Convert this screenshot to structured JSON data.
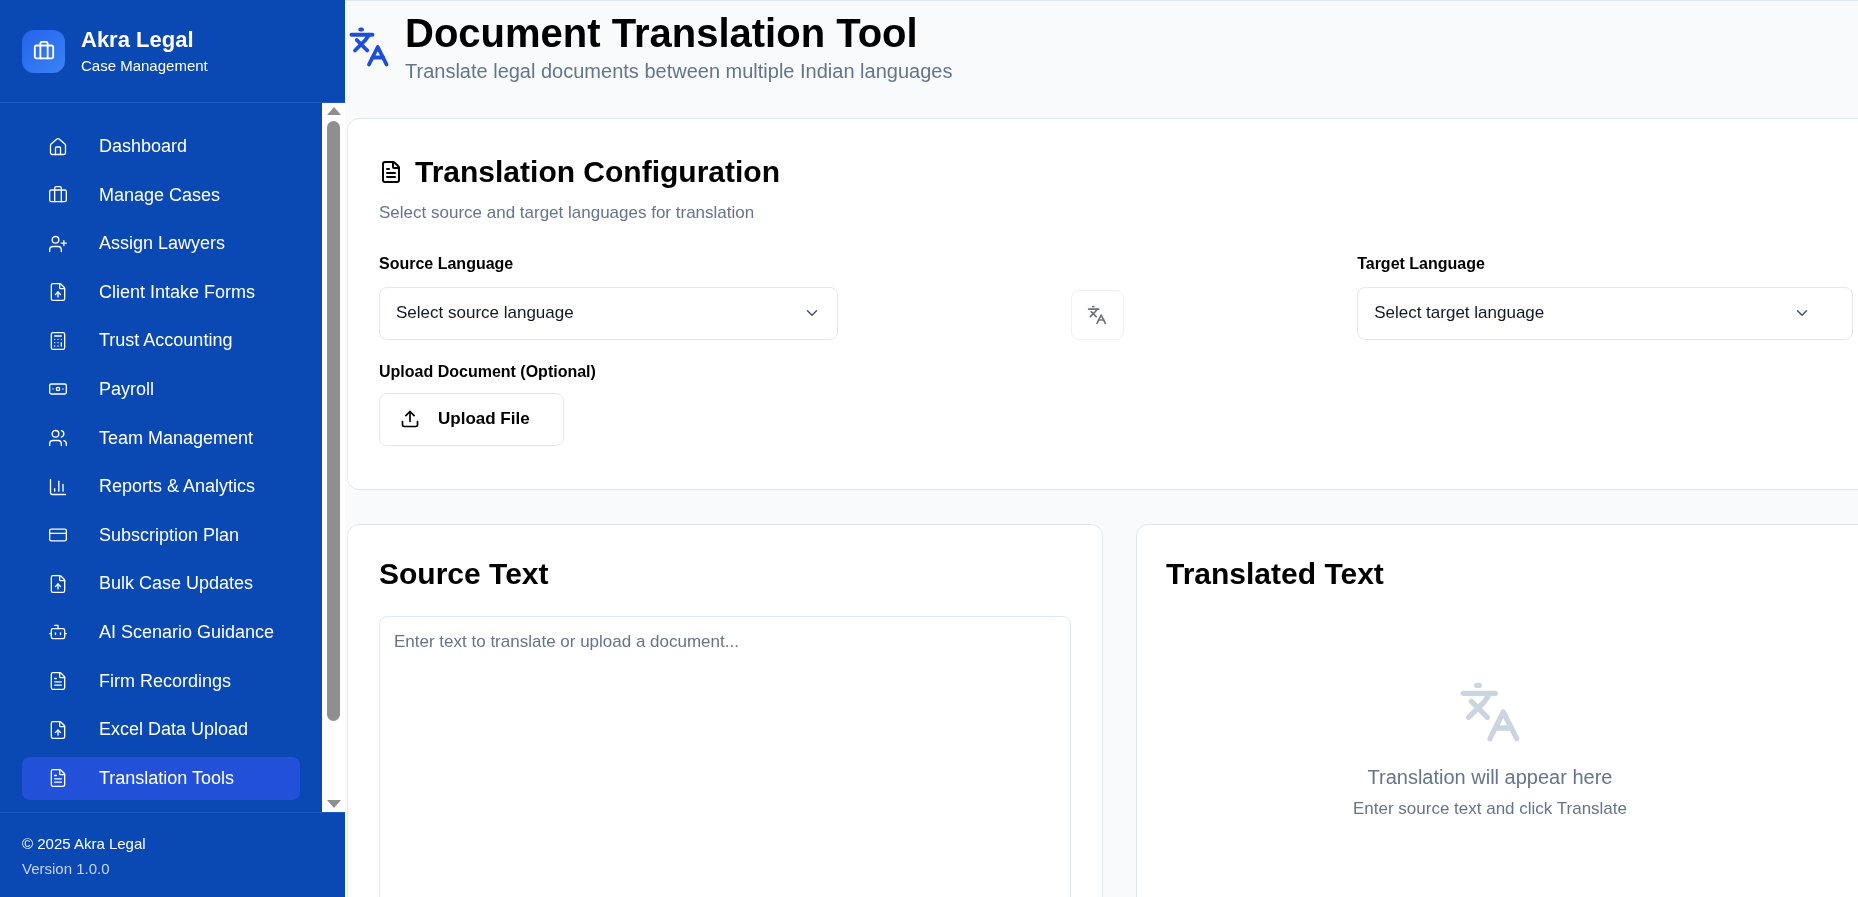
{
  "sidebar": {
    "brand": {
      "title": "Akra Legal",
      "subtitle": "Case Management"
    },
    "items": [
      {
        "label": "Dashboard",
        "selected": false
      },
      {
        "label": "Manage Cases",
        "selected": false
      },
      {
        "label": "Assign Lawyers",
        "selected": false
      },
      {
        "label": "Client Intake Forms",
        "selected": false
      },
      {
        "label": "Trust Accounting",
        "selected": false
      },
      {
        "label": "Payroll",
        "selected": false
      },
      {
        "label": "Team Management",
        "selected": false
      },
      {
        "label": "Reports & Analytics",
        "selected": false
      },
      {
        "label": "Subscription Plan",
        "selected": false
      },
      {
        "label": "Bulk Case Updates",
        "selected": false
      },
      {
        "label": "AI Scenario Guidance",
        "selected": false
      },
      {
        "label": "Firm Recordings",
        "selected": false
      },
      {
        "label": "Excel Data Upload",
        "selected": false
      },
      {
        "label": "Translation Tools",
        "selected": true
      }
    ],
    "footer": {
      "copyright": "© 2025 Akra Legal",
      "version": "Version 1.0.0"
    }
  },
  "header": {
    "title": "Document Translation Tool",
    "subtitle": "Translate legal documents between multiple Indian languages"
  },
  "config": {
    "title": "Translation Configuration",
    "subtitle": "Select source and target languages for translation",
    "source": {
      "label": "Source Language",
      "placeholder": "Select source language"
    },
    "target": {
      "label": "Target Language",
      "placeholder": "Select target language"
    },
    "upload": {
      "label": "Upload Document (Optional)",
      "button": "Upload File"
    }
  },
  "source_panel": {
    "title": "Source Text",
    "placeholder": "Enter text to translate or upload a document..."
  },
  "translated_panel": {
    "title": "Translated Text",
    "empty_title": "Translation will appear here",
    "empty_hint": "Enter source text and click Translate"
  }
}
